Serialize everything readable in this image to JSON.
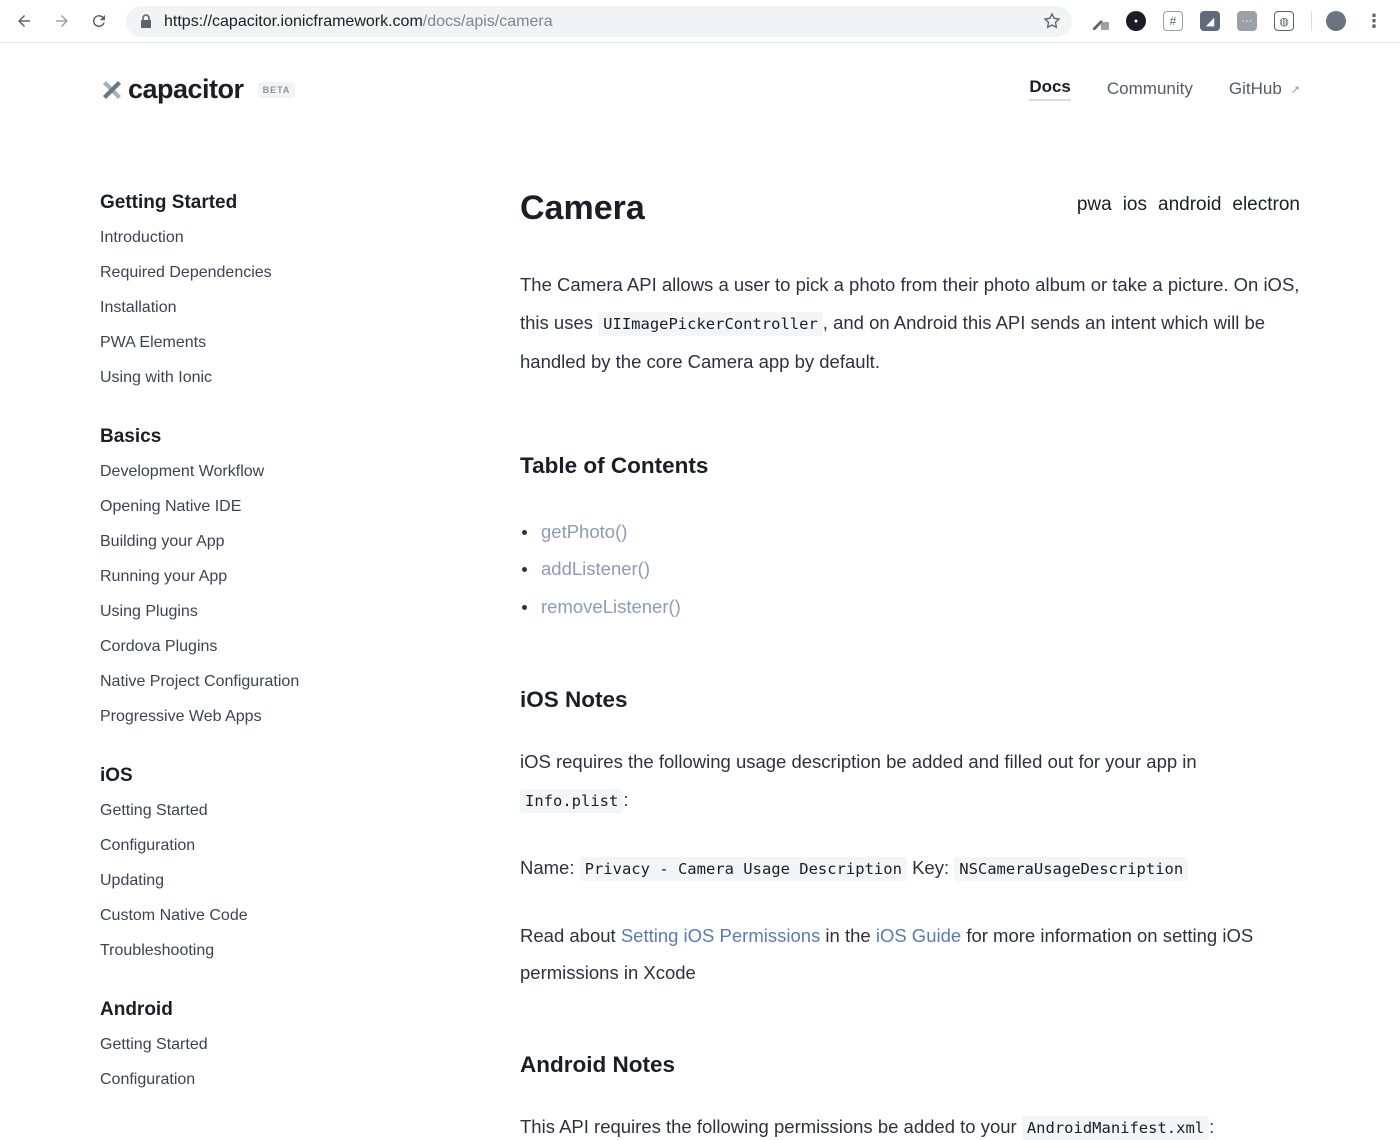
{
  "browser": {
    "url_host": "https://capacitor.ionicframework.com",
    "url_path": "/docs/apis/camera"
  },
  "header": {
    "logo_text": "capacitor",
    "beta_label": "BETA",
    "nav": [
      {
        "label": "Docs",
        "active": true
      },
      {
        "label": "Community"
      },
      {
        "label": "GitHub",
        "external": true
      }
    ]
  },
  "sidebar": {
    "groups": [
      {
        "title": "Getting Started",
        "items": [
          "Introduction",
          "Required Dependencies",
          "Installation",
          "PWA Elements",
          "Using with Ionic"
        ]
      },
      {
        "title": "Basics",
        "items": [
          "Development Workflow",
          "Opening Native IDE",
          "Building your App",
          "Running your App",
          "Using Plugins",
          "Cordova Plugins",
          "Native Project Configuration",
          "Progressive Web Apps"
        ]
      },
      {
        "title": "iOS",
        "items": [
          "Getting Started",
          "Configuration",
          "Updating",
          "Custom Native Code",
          "Troubleshooting"
        ]
      },
      {
        "title": "Android",
        "items": [
          "Getting Started",
          "Configuration"
        ]
      }
    ]
  },
  "main": {
    "title": "Camera",
    "platforms": [
      "pwa",
      "ios",
      "android",
      "electron"
    ],
    "intro": {
      "t1": "The Camera API allows a user to pick a photo from their photo album or take a picture. On iOS, this uses ",
      "code1": "UIImagePickerController",
      "t2": ", and on Android this API sends an intent which will be handled by the core Camera app by default."
    },
    "toc": {
      "title": "Table of Contents",
      "items": [
        "getPhoto()",
        "addListener()",
        "removeListener()"
      ]
    },
    "ios_notes": {
      "title": "iOS Notes",
      "p1_text": "iOS requires the following usage description be added and filled out for your app in ",
      "p1_code": "Info.plist",
      "p1_end": ":",
      "p2_name_label": "Name:",
      "p2_name_code": "Privacy - Camera Usage Description",
      "p2_key_label": "Key:",
      "p2_key_code": "NSCameraUsageDescription",
      "p3_t1": "Read about ",
      "p3_link1": "Setting iOS Permissions",
      "p3_t2": " in the ",
      "p3_link2": "iOS Guide",
      "p3_t3": " for more information on setting iOS permissions in Xcode"
    },
    "android_notes": {
      "title": "Android Notes",
      "p1_text": "This API requires the following permissions be added to your ",
      "p1_code": "AndroidManifest.xml",
      "p1_end": ":"
    }
  }
}
